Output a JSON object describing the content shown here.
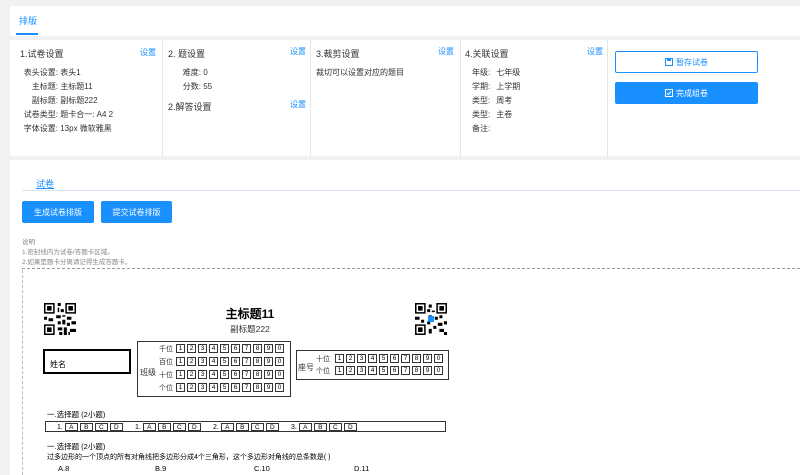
{
  "top_tab": {
    "label": "排版"
  },
  "config": {
    "col1": {
      "title": "1.试卷设置",
      "link": "设置",
      "rows": [
        {
          "k": "表头设置:",
          "v": "表头1"
        },
        {
          "k": "主标题:",
          "v": "主标题11"
        },
        {
          "k": "副标题:",
          "v": "副标题222"
        },
        {
          "k": "试卷类型:",
          "v": "题卡合一:    A4 2"
        },
        {
          "k": "字体设置:",
          "v": "13px 微软雅黑"
        }
      ]
    },
    "col2": {
      "title": "2. 题设置",
      "link": "设置",
      "rows": [
        {
          "k": "难度:",
          "v": "0"
        },
        {
          "k": "分数:",
          "v": "55"
        }
      ],
      "title2": "2.解答设置",
      "link2": "设置"
    },
    "col3": {
      "title": "3.裁剪设置",
      "link": "设置",
      "text": "裁切可以设置对应的题目"
    },
    "col4": {
      "title": "4.关联设置",
      "link": "设置",
      "rows": [
        {
          "k": "年级:",
          "v": "七年级"
        },
        {
          "k": "学期:",
          "v": "上学期"
        },
        {
          "k": "类型:",
          "v": "周考"
        },
        {
          "k": "类型:",
          "v": "主卷"
        },
        {
          "k": "备注:",
          "v": ""
        }
      ]
    },
    "save_button": "暂存试卷",
    "finish_button": "完成组卷"
  },
  "section": {
    "link": "试卷",
    "btn_generate": "生成试卷排版",
    "btn_submit": "提交试卷排版",
    "note_title": "说明",
    "note_1": "1.密封线内为试卷/答题卡区域。",
    "note_2": "2.如果是题卡分离请记得生成答题卡。"
  },
  "paper": {
    "title": "主标题11",
    "subtitle": "副标题222",
    "name_label": "姓名",
    "class_label": "班级",
    "seat_label": "座号",
    "digit_labels": [
      "千位",
      "百位",
      "十位",
      "个位"
    ],
    "digits": [
      "1",
      "2",
      "3",
      "4",
      "5",
      "6",
      "7",
      "8",
      "9",
      "0"
    ],
    "q1_heading": "一.选择题 (2小题)",
    "q_numbers": [
      "1.",
      "1.",
      "2.",
      "3."
    ],
    "options": [
      "A",
      "B",
      "C",
      "D"
    ],
    "q2_heading": "一.选择题 (2小题)",
    "q2_text": "过多边形的一个顶点的所有对角线把多边形分成4个三角形，这个多边形对角线的总条数是(    )",
    "choices": [
      "A.8",
      "B.9",
      "C.10",
      "D.11"
    ]
  },
  "colors": {
    "accent": "#1890ff",
    "page_bg": "#f0f1f3"
  }
}
